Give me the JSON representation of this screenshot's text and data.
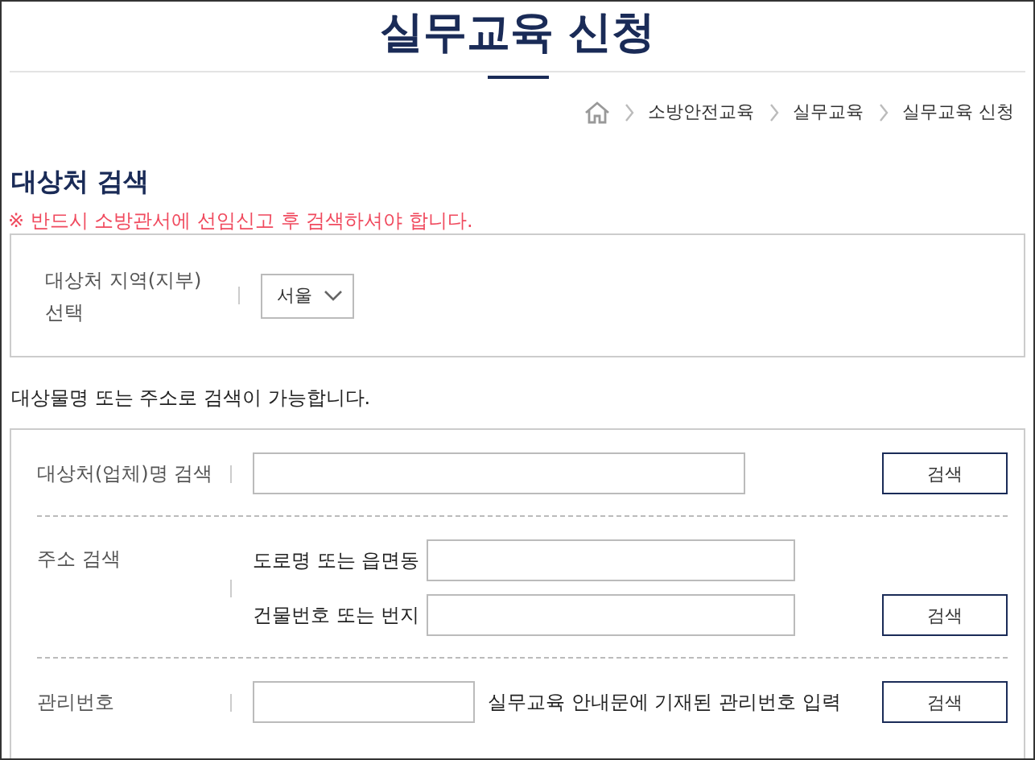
{
  "page_title": "실무교육 신청",
  "breadcrumb": [
    "소방안전교육",
    "실무교육",
    "실무교육 신청"
  ],
  "section_title": "대상처 검색",
  "notice": "※ 반드시 소방관서에 선임신고 후 검색하셔야 합니다.",
  "region": {
    "label": "대상처 지역(지부) 선택",
    "value": "서울"
  },
  "info": "대상물명 또는 주소로 검색이 가능합니다.",
  "search_rows": [
    {
      "kind": "single",
      "label": "대상처(업체)명 검색",
      "button": "검색"
    },
    {
      "kind": "address",
      "label": "주소 검색",
      "fields": [
        {
          "label": "도로명 또는 읍면동"
        },
        {
          "label": "건물번호 또는 번지"
        }
      ],
      "button": "검색"
    },
    {
      "kind": "short",
      "label": "관리번호",
      "hint": "실무교육 안내문에 기재된 관리번호 입력",
      "button": "검색"
    }
  ]
}
